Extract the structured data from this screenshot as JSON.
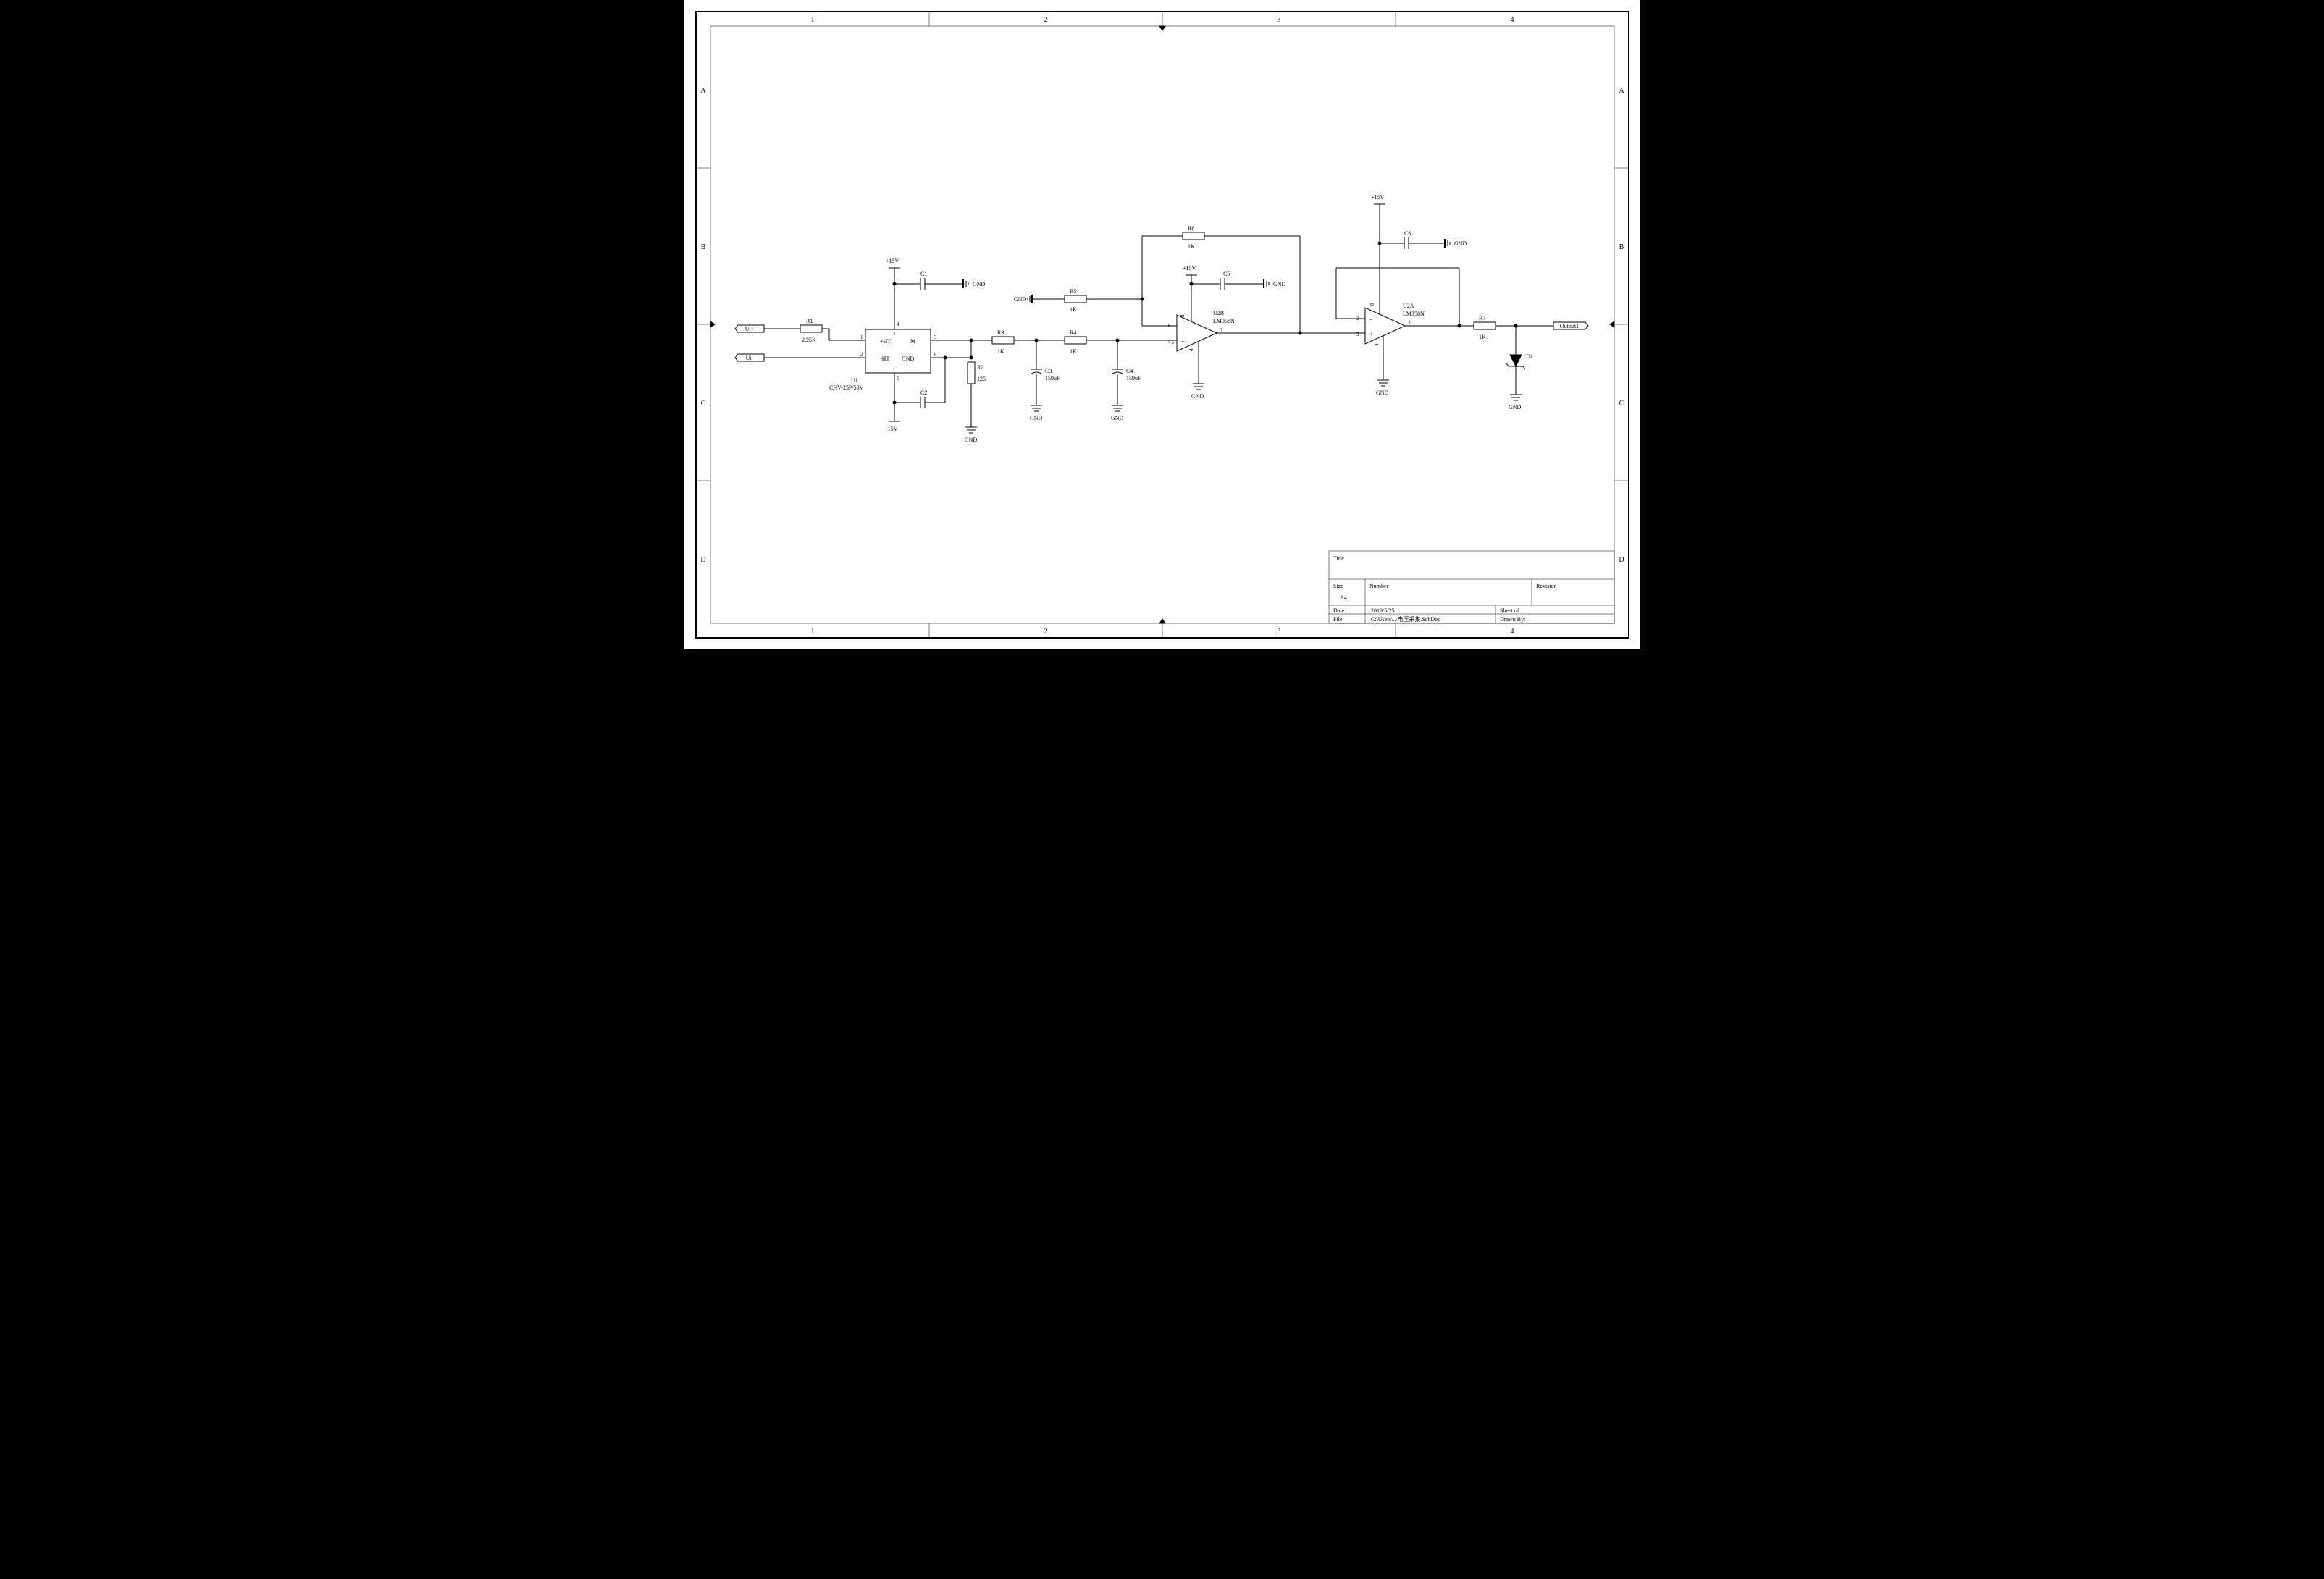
{
  "border": {
    "cols": [
      "1",
      "2",
      "3",
      "4"
    ],
    "rows": [
      "A",
      "B",
      "C",
      "D"
    ]
  },
  "ports": {
    "ui_plus": "Ui+",
    "ui_minus": "Ui-",
    "output": "Output1"
  },
  "components": {
    "R1": {
      "ref": "R1",
      "val": "2.25K"
    },
    "R2": {
      "ref": "R2",
      "val": "125"
    },
    "R3": {
      "ref": "R3",
      "val": "1K"
    },
    "R4": {
      "ref": "R4",
      "val": "1K"
    },
    "R5": {
      "ref": "R5",
      "val": "1K"
    },
    "R6": {
      "ref": "R6",
      "val": "1K"
    },
    "R7": {
      "ref": "R7",
      "val": "1K"
    },
    "C1": {
      "ref": "C1",
      "val": ""
    },
    "C2": {
      "ref": "C2",
      "val": ""
    },
    "C3": {
      "ref": "C3",
      "val": "159uF"
    },
    "C4": {
      "ref": "C4",
      "val": "159uF"
    },
    "C5": {
      "ref": "C5",
      "val": ""
    },
    "C6": {
      "ref": "C6",
      "val": ""
    },
    "U1": {
      "ref": "U1",
      "val": "CHV-25P/50V",
      "pin_ht_p": "+HT",
      "pin_ht_m": "-HT",
      "pin_M": "M",
      "pin_GND": "GND",
      "pin_plus": "+",
      "pin_minus": "-",
      "p1": "1",
      "p2": "2",
      "p3": "3",
      "p4": "4",
      "p5": "5",
      "p6": "6"
    },
    "U2A": {
      "ref": "U2A",
      "val": "LM358N",
      "p1": "1",
      "p2": "2",
      "p3": "3",
      "p4": "4",
      "p8": "8"
    },
    "U2B": {
      "ref": "U2B",
      "val": "LM358N",
      "p5": "5",
      "p6": "6",
      "p7": "7",
      "p4": "4",
      "p8": "8"
    },
    "D1": {
      "ref": "D1"
    }
  },
  "nets": {
    "gnd": "GND",
    "p15": "+15V",
    "m15": "-15V"
  },
  "titleblock": {
    "title_label": "Title",
    "size_label": "Size",
    "size_val": "A4",
    "number_label": "Number",
    "revision_label": "Revision",
    "date_label": "Date:",
    "date_val": "2019/5/25",
    "file_label": "File:",
    "file_val": "C:\\Users\\..\\电压采集.SchDoc",
    "sheet_label": "Sheet    of",
    "drawn_label": "Drawn By:"
  }
}
